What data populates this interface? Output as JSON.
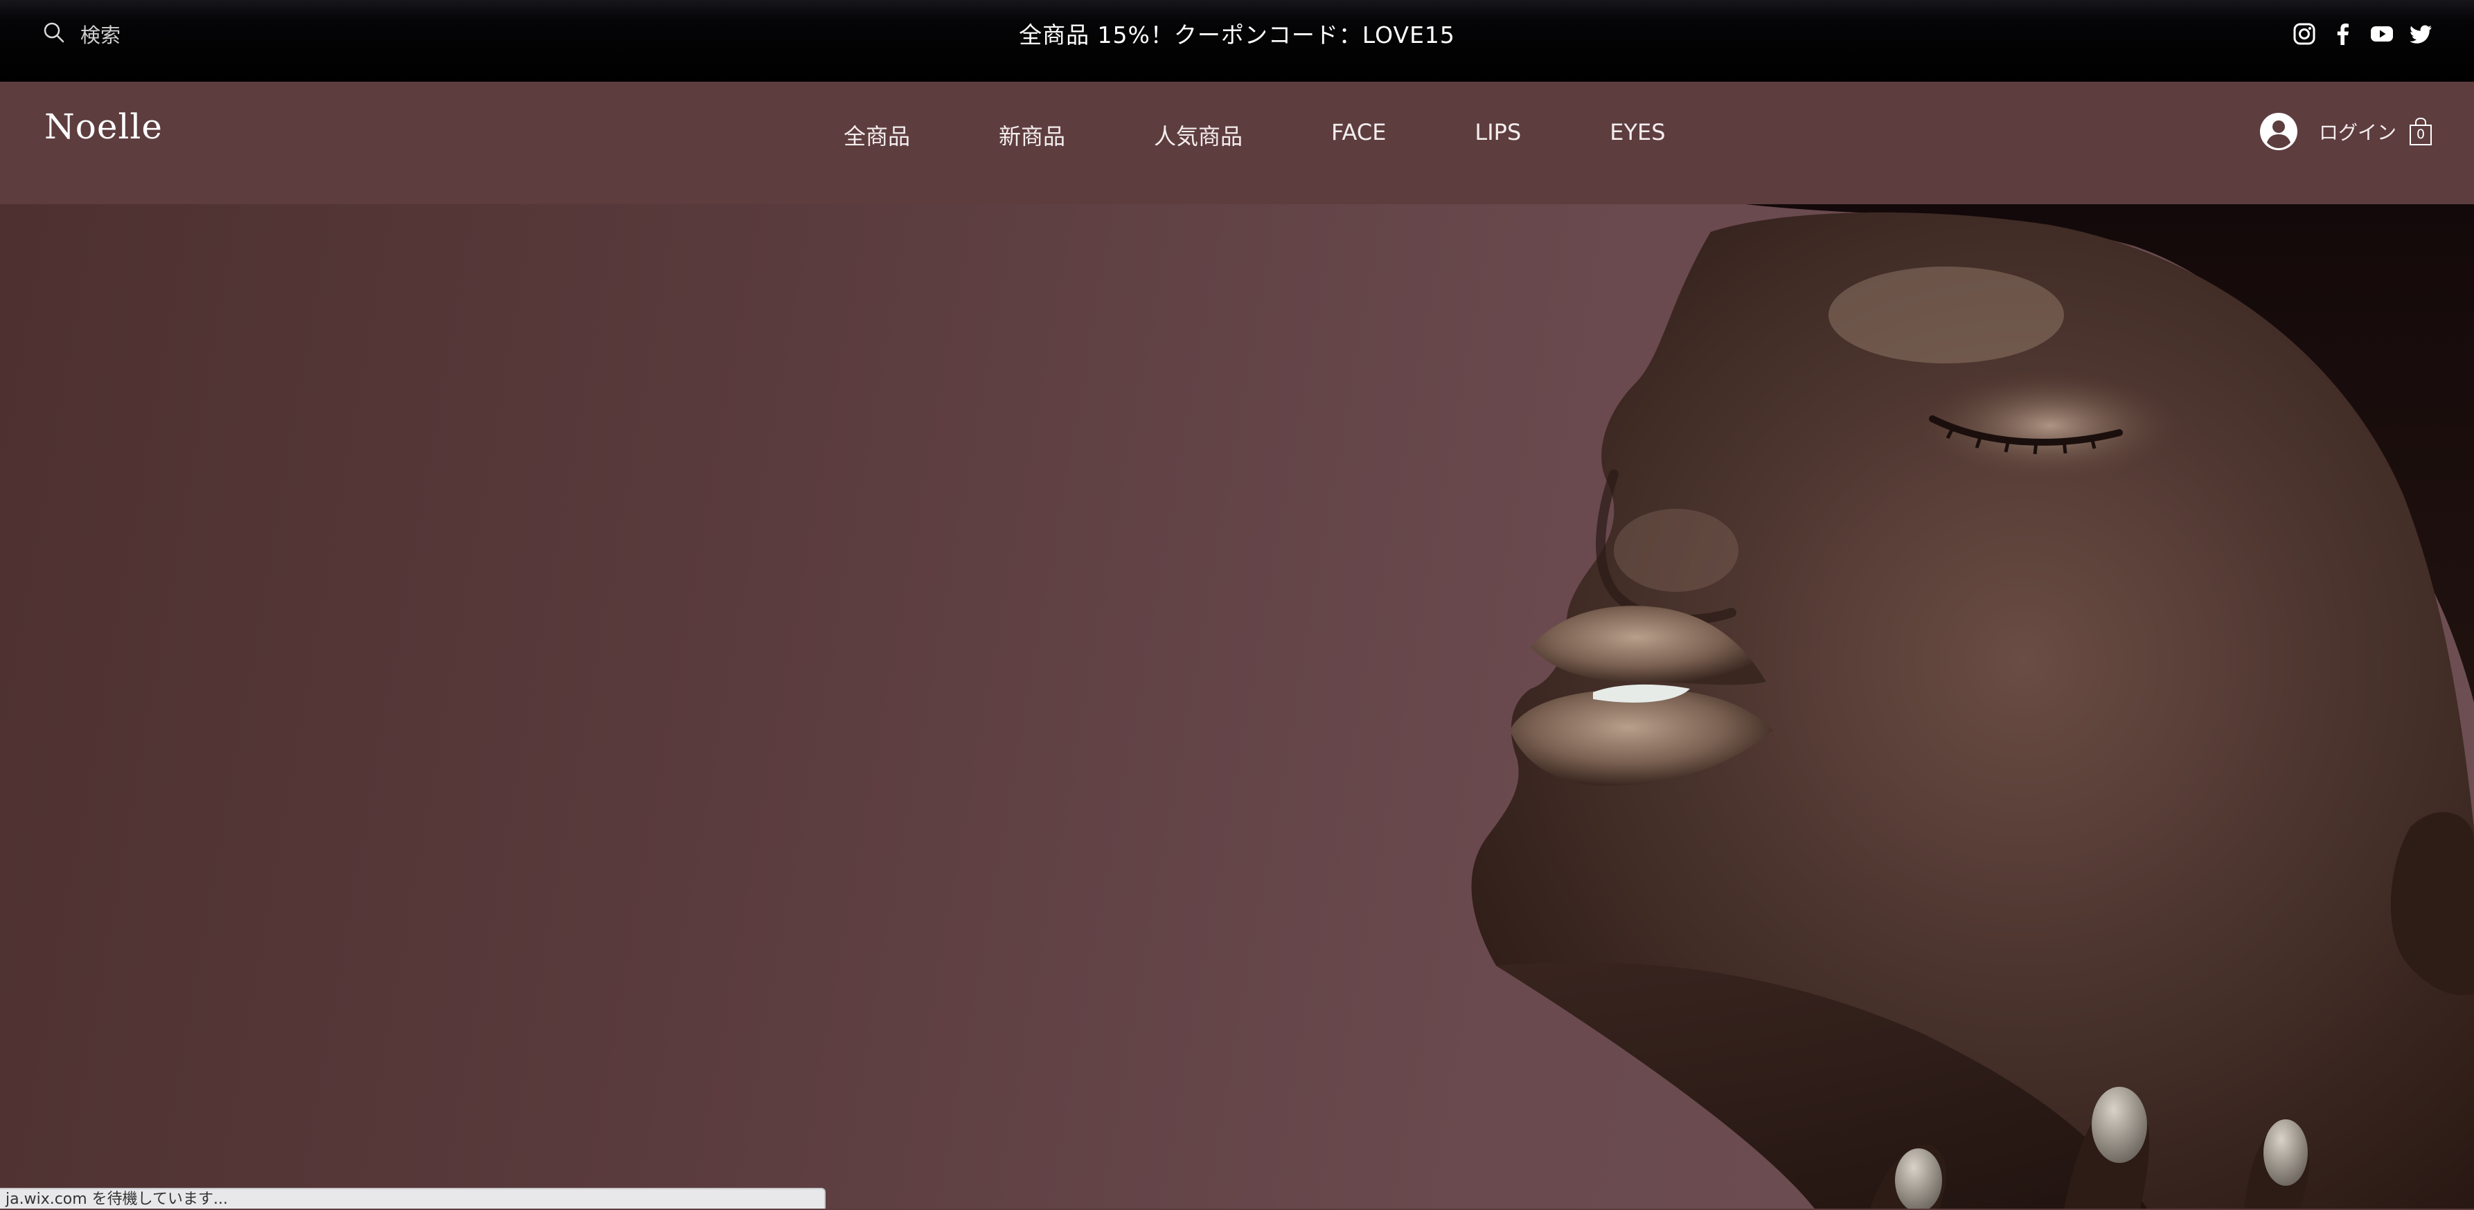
{
  "announcement": {
    "search_label": "検索",
    "promo_text": "全商品 15%！クーポンコード：LOVE15",
    "social": [
      "instagram-icon",
      "facebook-icon",
      "youtube-icon",
      "twitter-icon"
    ]
  },
  "header": {
    "logo": "Noelle",
    "nav": [
      "全商品",
      "新商品",
      "人気商品",
      "FACE",
      "LIPS",
      "EYES"
    ],
    "login_label": "ログイン",
    "cart_count": "0"
  },
  "hero": {
    "image": "portrait-model-gold-makeup"
  },
  "status_bar": {
    "text": "ja.wix.com を待機しています..."
  },
  "colors": {
    "announcement_bg": "#000000",
    "header_bg": "#5e3d3f",
    "hero_bg": "#5a3b3d",
    "text": "#ffffff"
  }
}
